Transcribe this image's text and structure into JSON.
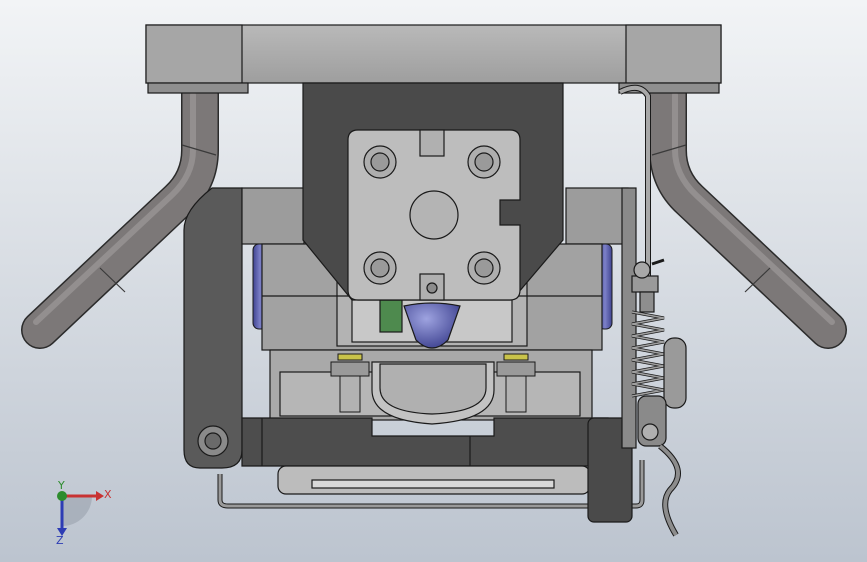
{
  "scene": {
    "background_top": "#f2f4f6",
    "background_bottom": "#bcc4cf",
    "colors": {
      "steel_light": "#a3a3a3",
      "steel_mid": "#8d8d8d",
      "steel_dark": "#6f6f6f",
      "dark_block": "#4b4b4b",
      "plate": "#bfbfbf",
      "tube": "#7b7878",
      "blue_part": "#5d62a8",
      "green_part": "#4e8a4e",
      "yellow_ring": "#c9c34a",
      "outline": "#1a1a1a"
    }
  },
  "triad": {
    "x_label": "X",
    "y_label": "Y",
    "z_label": "Z",
    "x_color": "#c83232",
    "y_color": "#2d8c2d",
    "z_color": "#2d3cb4"
  }
}
